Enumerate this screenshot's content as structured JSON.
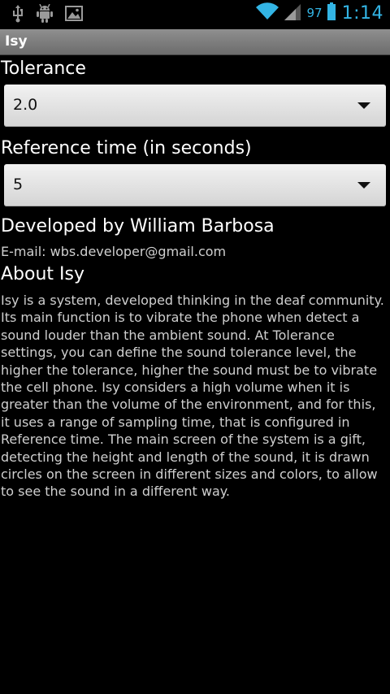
{
  "status_bar": {
    "battery": "97",
    "time": "1:14",
    "icons": [
      "usb-icon",
      "android-debug-icon",
      "gallery-icon",
      "wifi-icon",
      "signal-icon",
      "battery-icon"
    ],
    "accent_color": "#33b5e5"
  },
  "action_bar": {
    "title": "Isy"
  },
  "settings": {
    "tolerance_label": "Tolerance",
    "tolerance_value": "2.0",
    "reference_label": "Reference time (in seconds)",
    "reference_value": "5"
  },
  "about": {
    "developed_by": "Developed by William Barbosa",
    "email": "E-mail: wbs.developer@gmail.com",
    "title": "About Isy",
    "body": "Isy is a system, developed thinking in the deaf community. Its main function is to vibrate the phone when detect a sound louder than the ambient sound. At Tolerance settings, you can define the sound tolerance level, the higher the tolerance, higher the sound must be to vibrate the cell phone. Isy considers a high volume when it is greater than the volume of the environment, and for this, it uses a range of sampling time, that is configured in Reference time. The main screen of the system is a gift, detecting the height and length of the sound, it is drawn circles on the screen in different sizes and colors, to allow to see the sound in a different way."
  }
}
